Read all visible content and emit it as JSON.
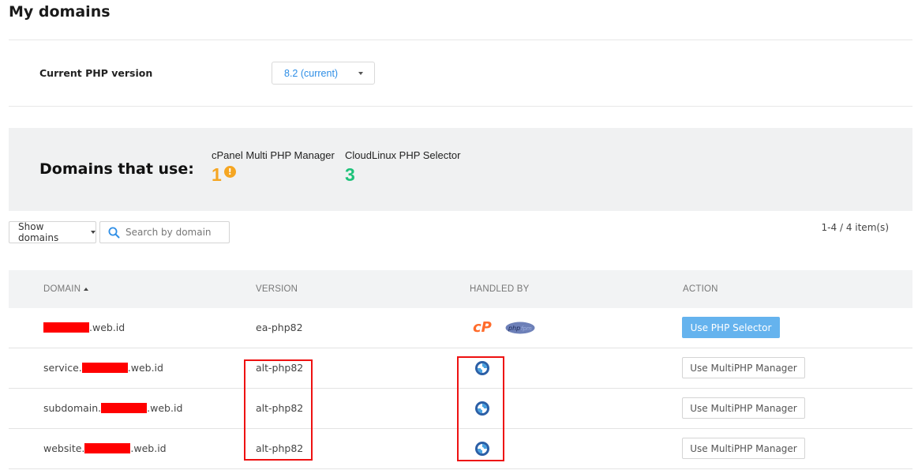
{
  "page_title": "My domains",
  "php": {
    "label": "Current PHP version",
    "selected": "8.2 (current)"
  },
  "usage": {
    "title": "Domains that use:",
    "cpanel": {
      "label": "cPanel Multi PHP Manager",
      "count": "1",
      "info": "!",
      "color": "#f5a623"
    },
    "cloudlinux": {
      "label": "CloudLinux PHP Selector",
      "count": "3",
      "color": "#1ec27a"
    }
  },
  "toolbar": {
    "show_label": "Show domains",
    "search_placeholder": "Search by domain",
    "pager": "1-4 / 4 item(s)"
  },
  "table": {
    "headers": {
      "domain": "DOMAIN",
      "version": "VERSION",
      "handled_by": "HANDLED BY",
      "action": "ACTION"
    },
    "rows": [
      {
        "domain_prefix": "",
        "domain_suffix": ".web.id",
        "version": "ea-php82",
        "handled_by": "cpanel-php-fpm",
        "action": "Use PHP Selector"
      },
      {
        "domain_prefix": "service.",
        "domain_suffix": ".web.id",
        "version": "alt-php82",
        "handled_by": "cloudlinux",
        "action": "Use MultiPHP Manager"
      },
      {
        "domain_prefix": "subdomain.",
        "domain_suffix": ".web.id",
        "version": "alt-php82",
        "handled_by": "cloudlinux",
        "action": "Use MultiPHP Manager"
      },
      {
        "domain_prefix": "website.",
        "domain_suffix": ".web.id",
        "version": "alt-php82",
        "handled_by": "cloudlinux",
        "action": "Use MultiPHP Manager"
      }
    ]
  },
  "icons": {
    "search": "search-icon",
    "cpanel": "cpanel-logo-icon",
    "phpfpm": "php-fpm-logo-icon",
    "cloudlinux": "cloudlinux-logo-icon"
  },
  "colors": {
    "accent": "#2e8ee6",
    "primary_button": "#65b3ee",
    "highlight": "#ee1111",
    "redaction": "#ff0000"
  }
}
